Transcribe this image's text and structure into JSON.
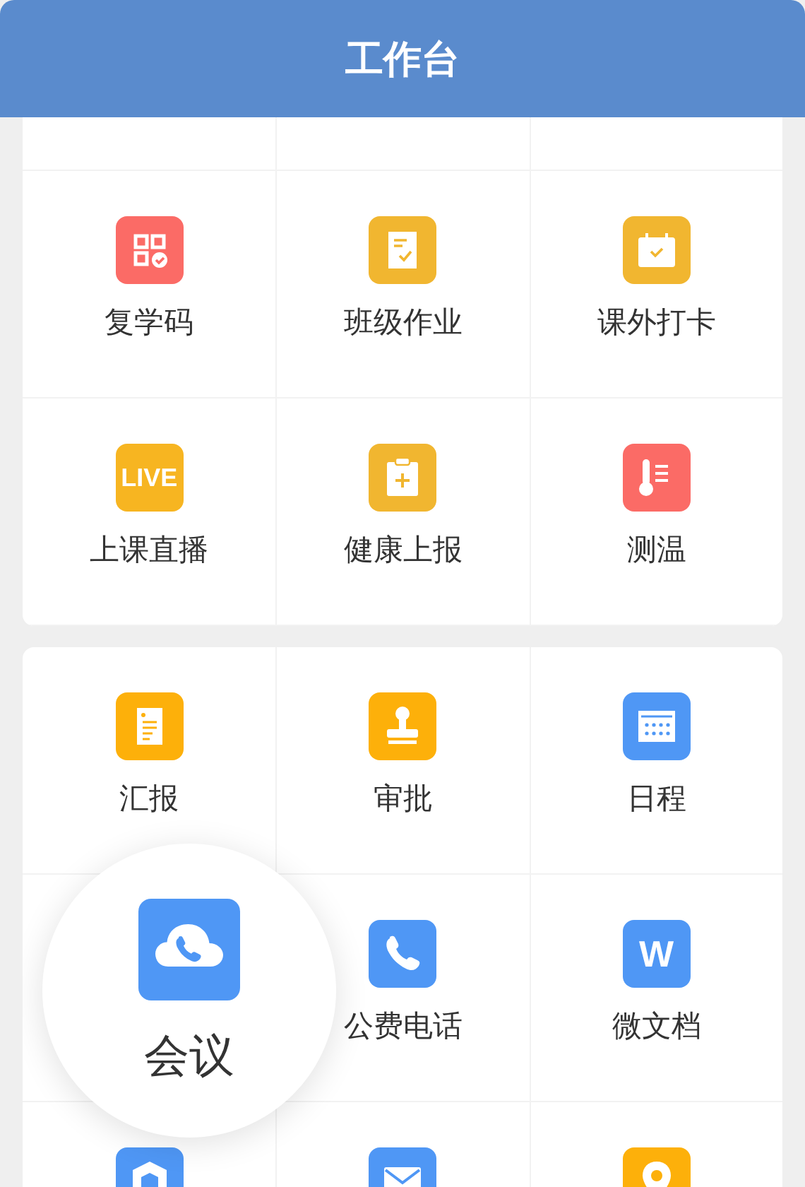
{
  "header": {
    "title": "工作台"
  },
  "sections": [
    {
      "top_row_cut": true,
      "items": [
        {
          "kind": "app",
          "label": "复学码",
          "color": "#fb6b66"
        },
        {
          "kind": "app",
          "label": "班级作业",
          "color": "#f1b630"
        },
        {
          "kind": "app",
          "label": "课外打卡",
          "color": "#f1b630"
        },
        {
          "kind": "app",
          "label": "上课直播",
          "color": "#f7b521",
          "icon_text": "LIVE"
        },
        {
          "kind": "app",
          "label": "健康上报",
          "color": "#f1b630"
        },
        {
          "kind": "app",
          "label": "测温",
          "color": "#fb6b66"
        }
      ]
    },
    {
      "top_row_cut": false,
      "items": [
        {
          "kind": "app",
          "label": "汇报",
          "color": "#fdb00a"
        },
        {
          "kind": "app",
          "label": "审批",
          "color": "#fdb00a"
        },
        {
          "kind": "app",
          "label": "日程",
          "color": "#4f97f5"
        },
        {
          "kind": "magnified",
          "label": "会议",
          "color": "#4f97f5"
        },
        {
          "kind": "app",
          "label": "公费电话",
          "color": "#4f97f5"
        },
        {
          "kind": "app",
          "label": "微文档",
          "color": "#4f97f5",
          "icon_text": "W"
        },
        {
          "kind": "app",
          "color": "#4f97f5"
        },
        {
          "kind": "app",
          "color": "#4f97f5"
        },
        {
          "kind": "app",
          "color": "#fdb00a"
        }
      ]
    }
  ]
}
